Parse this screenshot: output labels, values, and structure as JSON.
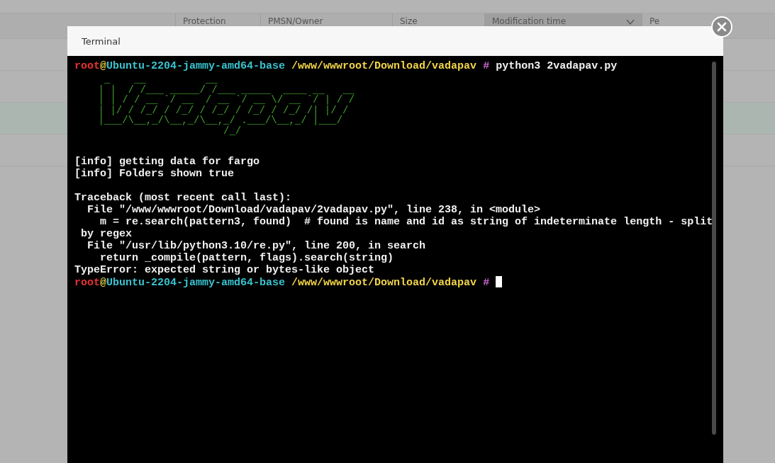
{
  "background_table": {
    "columns": [
      {
        "label": "Protection",
        "sorted": false
      },
      {
        "label": "PMSN/Owner",
        "sorted": false
      },
      {
        "label": "Size",
        "sorted": false
      },
      {
        "label": "Modification time",
        "sorted": true
      },
      {
        "label": "Pe",
        "sorted": false
      }
    ]
  },
  "window": {
    "title": "Terminal"
  },
  "terminal": {
    "lines": [
      {
        "kind": "text",
        "segments": [
          {
            "text": "root",
            "color": "#e8322f"
          },
          {
            "text": "@",
            "color": "#f2d548"
          },
          {
            "text": "Ubuntu-2204-jammy-amd64-base ",
            "color": "#39c3cf"
          },
          {
            "text": "/www/wwwroot/Download/vadapav ",
            "color": "#f2d548"
          },
          {
            "text": "# ",
            "color": "#c467c6"
          },
          {
            "text": "python3 2vadapav.py",
            "color": "#f0f0f0"
          }
        ]
      },
      {
        "kind": "art",
        "color": "#3fa02c",
        "art": [
          "     _    __          __",
          "    | |  / /___ _____/ /___ _____  ____ __   __",
          "    | | / / __ `/ __  / __ `/ __ \\/ __ `/ | / /",
          "    | |/ / /_/ / /_/ / /_/ / /_/ / /_/ /| |/ /",
          "    |___/\\__,_/\\__,_/\\__,_/ .___/\\__,_/ |___/",
          "                         /_/"
        ]
      },
      {
        "kind": "blank"
      },
      {
        "kind": "text",
        "segments": [
          {
            "text": "[info] getting data for fargo",
            "color": "#f0f0f0"
          }
        ]
      },
      {
        "kind": "text",
        "segments": [
          {
            "text": "[info] Folders shown true",
            "color": "#f0f0f0"
          }
        ]
      },
      {
        "kind": "blank"
      },
      {
        "kind": "text",
        "segments": [
          {
            "text": "Traceback (most recent call last):",
            "color": "#f0f0f0"
          }
        ]
      },
      {
        "kind": "text",
        "segments": [
          {
            "text": "  File \"/www/wwwroot/Download/vadapav/2vadapav.py\", line 238, in <module>",
            "color": "#f0f0f0"
          }
        ]
      },
      {
        "kind": "text",
        "segments": [
          {
            "text": "    m = re.search(pattern3, found)  # found is name and id as string of indeterminate length - split",
            "color": "#f0f0f0"
          }
        ]
      },
      {
        "kind": "text",
        "segments": [
          {
            "text": " by regex",
            "color": "#f0f0f0"
          }
        ]
      },
      {
        "kind": "text",
        "segments": [
          {
            "text": "  File \"/usr/lib/python3.10/re.py\", line 200, in search",
            "color": "#f0f0f0"
          }
        ]
      },
      {
        "kind": "text",
        "segments": [
          {
            "text": "    return _compile(pattern, flags).search(string)",
            "color": "#f0f0f0"
          }
        ]
      },
      {
        "kind": "text",
        "segments": [
          {
            "text": "TypeError: expected string or bytes-like object",
            "color": "#f0f0f0"
          }
        ]
      },
      {
        "kind": "text",
        "cursor": true,
        "segments": [
          {
            "text": "root",
            "color": "#e8322f"
          },
          {
            "text": "@",
            "color": "#f2d548"
          },
          {
            "text": "Ubuntu-2204-jammy-amd64-base ",
            "color": "#39c3cf"
          },
          {
            "text": "/www/wwwroot/Download/vadapav ",
            "color": "#f2d548"
          },
          {
            "text": "# ",
            "color": "#c467c6"
          }
        ]
      }
    ]
  }
}
